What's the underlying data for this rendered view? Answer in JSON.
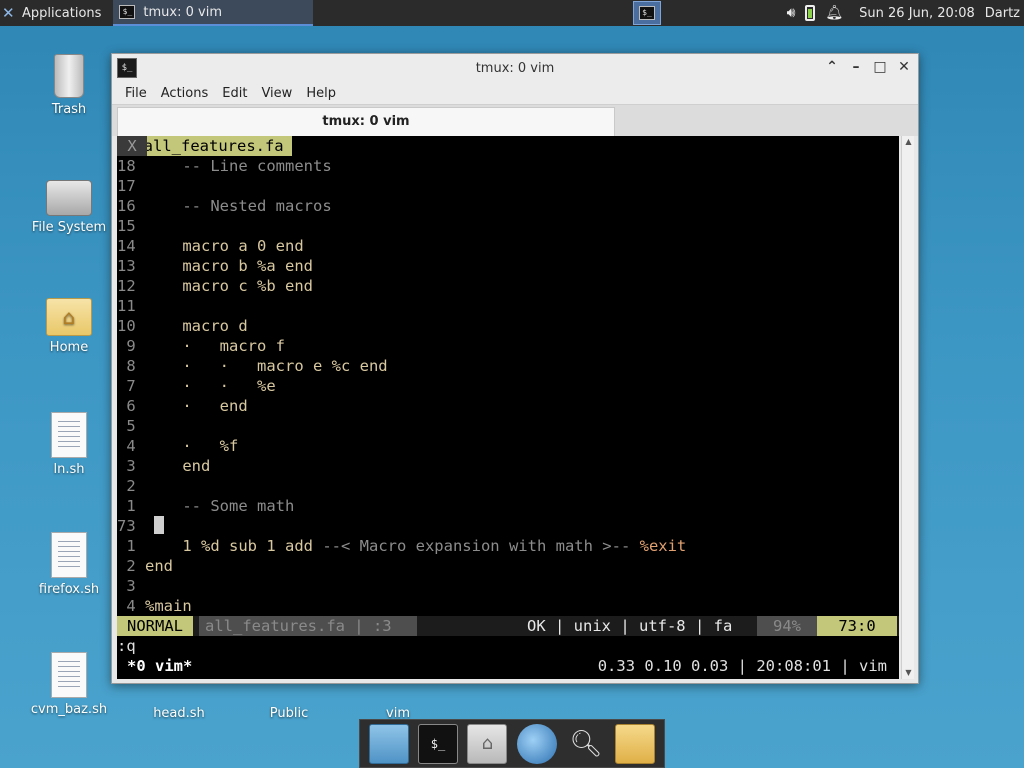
{
  "panel": {
    "apps_label": "Applications",
    "task_title": "tmux: 0 vim",
    "clock": "Sun 26 Jun, 20:08",
    "user": "Dartz"
  },
  "desktop_icons": [
    {
      "label": "Trash"
    },
    {
      "label": "File System"
    },
    {
      "label": "Home"
    },
    {
      "label": "ln.sh"
    },
    {
      "label": "firefox.sh"
    },
    {
      "label": "cvm_baz.sh"
    },
    {
      "label": "head.sh"
    },
    {
      "label": "Public"
    },
    {
      "label": "vim"
    }
  ],
  "window": {
    "title": "tmux: 0 vim",
    "menu": [
      "File",
      "Actions",
      "Edit",
      "View",
      "Help"
    ],
    "tab_label": "tmux: 0 vim"
  },
  "vim": {
    "buffer_tab": "1 all_features.fa",
    "buffer_close": "X",
    "lines": [
      {
        "ln": "18",
        "text": "    -- Line comments",
        "cls": "cmt"
      },
      {
        "ln": "17",
        "text": "",
        "cls": ""
      },
      {
        "ln": "16",
        "text": "    -- Nested macros",
        "cls": "cmt"
      },
      {
        "ln": "15",
        "text": "",
        "cls": ""
      },
      {
        "ln": "14",
        "text": "    macro a 0 end",
        "cls": "kw"
      },
      {
        "ln": "13",
        "text": "    macro b %a end",
        "cls": "kw"
      },
      {
        "ln": "12",
        "text": "    macro c %b end",
        "cls": "kw"
      },
      {
        "ln": "11",
        "text": "",
        "cls": ""
      },
      {
        "ln": "10",
        "text": "    macro d",
        "cls": "kw"
      },
      {
        "ln": " 9",
        "text": "    ·   macro f",
        "cls": "kw"
      },
      {
        "ln": " 8",
        "text": "    ·   ·   macro e %c end",
        "cls": "kw"
      },
      {
        "ln": " 7",
        "text": "    ·   ·   %e",
        "cls": "kw"
      },
      {
        "ln": " 6",
        "text": "    ·   end",
        "cls": "kw"
      },
      {
        "ln": " 5",
        "text": "",
        "cls": ""
      },
      {
        "ln": " 4",
        "text": "    ·   %f",
        "cls": "kw"
      },
      {
        "ln": " 3",
        "text": "    end",
        "cls": "kw"
      },
      {
        "ln": " 2",
        "text": "",
        "cls": ""
      },
      {
        "ln": " 1",
        "text": "    -- Some math",
        "cls": "cmt"
      },
      {
        "ln": "73",
        "text": "",
        "cls": "cursor"
      },
      {
        "ln": " 1",
        "text": "    1 %d sub 1 add --< Macro expansion with math >-- %exit",
        "cls": "mix"
      },
      {
        "ln": " 2",
        "text": "end",
        "cls": "kw"
      },
      {
        "ln": " 3",
        "text": "",
        "cls": ""
      },
      {
        "ln": " 4",
        "text": "%main",
        "cls": "kw"
      }
    ],
    "status": {
      "mode": "NORMAL",
      "file": "all_features.fa | :3",
      "info": "OK | unix | utf-8 | fa",
      "percent": "94%",
      "position": "73:0"
    },
    "command": ":q"
  },
  "tmux": {
    "window": "*0 vim*",
    "right": "0.33 0.10 0.03 | 20:08:01 | vim"
  }
}
